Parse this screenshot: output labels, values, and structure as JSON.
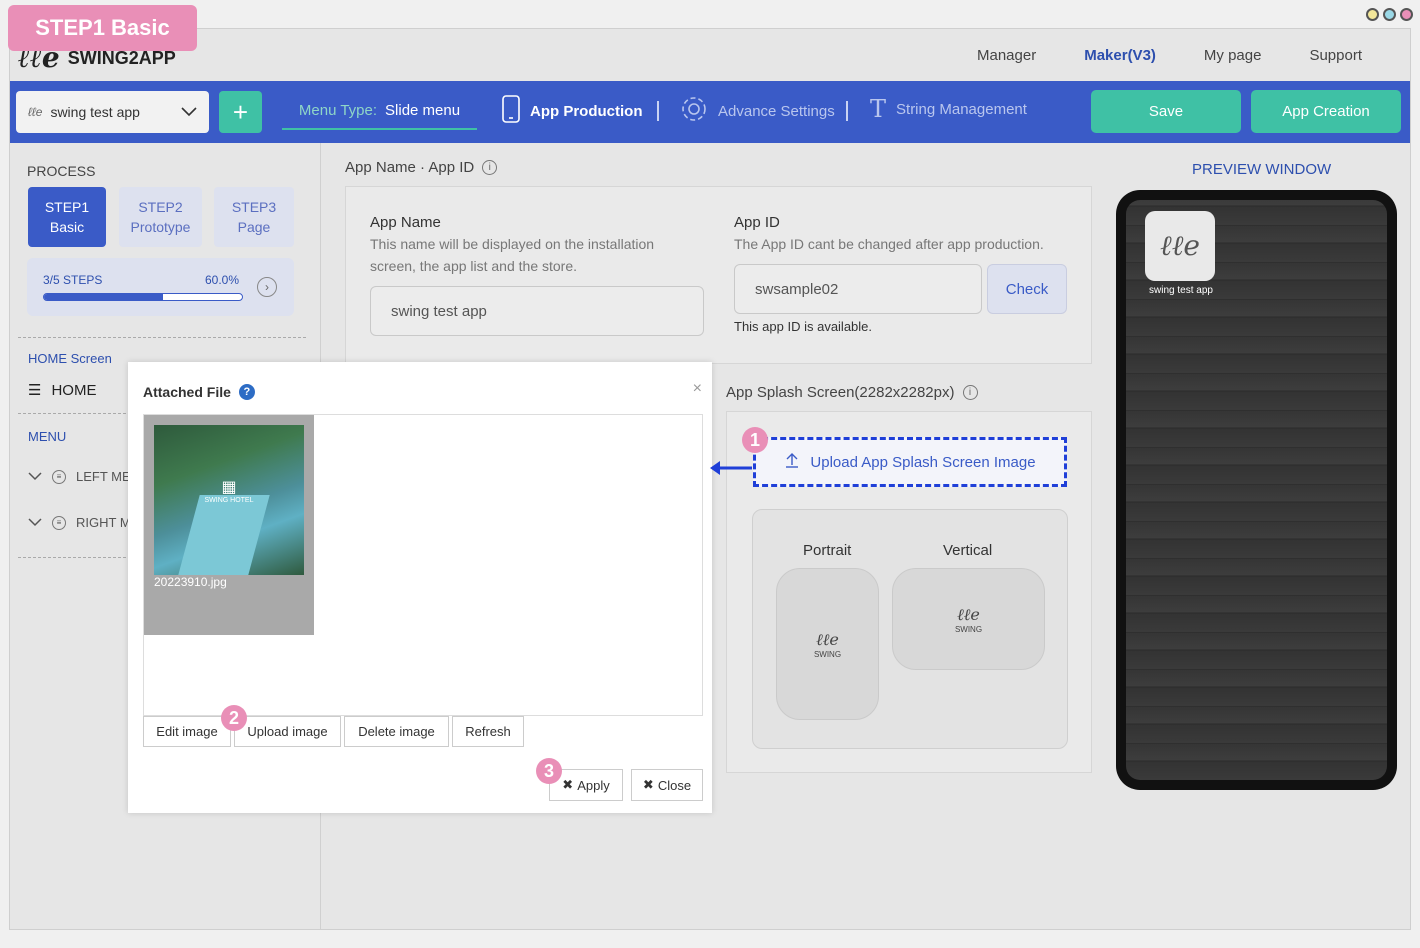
{
  "badge": "STEP1 Basic",
  "header": {
    "logo": "SWING2APP",
    "nav": [
      "Manager",
      "Maker(V3)",
      "My page",
      "Support"
    ],
    "active_nav": "Maker(V3)"
  },
  "toolbar": {
    "app_select": "swing test app",
    "menu_type_label": "Menu Type:",
    "menu_type_value": "Slide menu",
    "tabs": [
      "App Production",
      "Advance Settings",
      "String Management"
    ],
    "save": "Save",
    "app_creation": "App Creation"
  },
  "sidebar": {
    "process": "PROCESS",
    "steps": [
      {
        "line1": "STEP1",
        "line2": "Basic"
      },
      {
        "line1": "STEP2",
        "line2": "Prototype"
      },
      {
        "line1": "STEP3",
        "line2": "Page"
      }
    ],
    "progress_steps": "3/5 STEPS",
    "progress_pct": "60.0%",
    "progress_value": 0.6,
    "home_screen": "HOME Screen",
    "home": "HOME",
    "menu": "MENU",
    "left_menu": "LEFT MENU",
    "right_menu": "RIGHT MENU"
  },
  "main": {
    "appname_section": "App Name · App ID",
    "app_name_label": "App Name",
    "app_name_desc": "This name will be displayed on the installation screen, the app list and the store.",
    "app_name_value": "swing test app",
    "app_id_label": "App ID",
    "app_id_desc": "The App ID cant be changed after app production.",
    "app_id_value": "swsample02",
    "check": "Check",
    "available": "This app ID is available.",
    "splash_section": "App Splash Screen(2282x2282px)",
    "upload_splash": "Upload App Splash Screen Image",
    "portrait": "Portrait",
    "vertical": "Vertical",
    "splash_brand": "SWING"
  },
  "preview": {
    "title": "PREVIEW WINDOW",
    "app_label": "swing test app"
  },
  "modal": {
    "title": "Attached File",
    "file_name": "20223910.jpg",
    "thumb_text": "SWING HOTEL",
    "buttons": [
      "Edit image",
      "Upload image",
      "Delete image",
      "Refresh"
    ],
    "apply": "Apply",
    "close": "Close"
  },
  "callouts": [
    "1",
    "2",
    "3"
  ],
  "colors": {
    "primary": "#3a5bc7",
    "accent": "#3fc1a5",
    "badge": "#e98fb7"
  }
}
